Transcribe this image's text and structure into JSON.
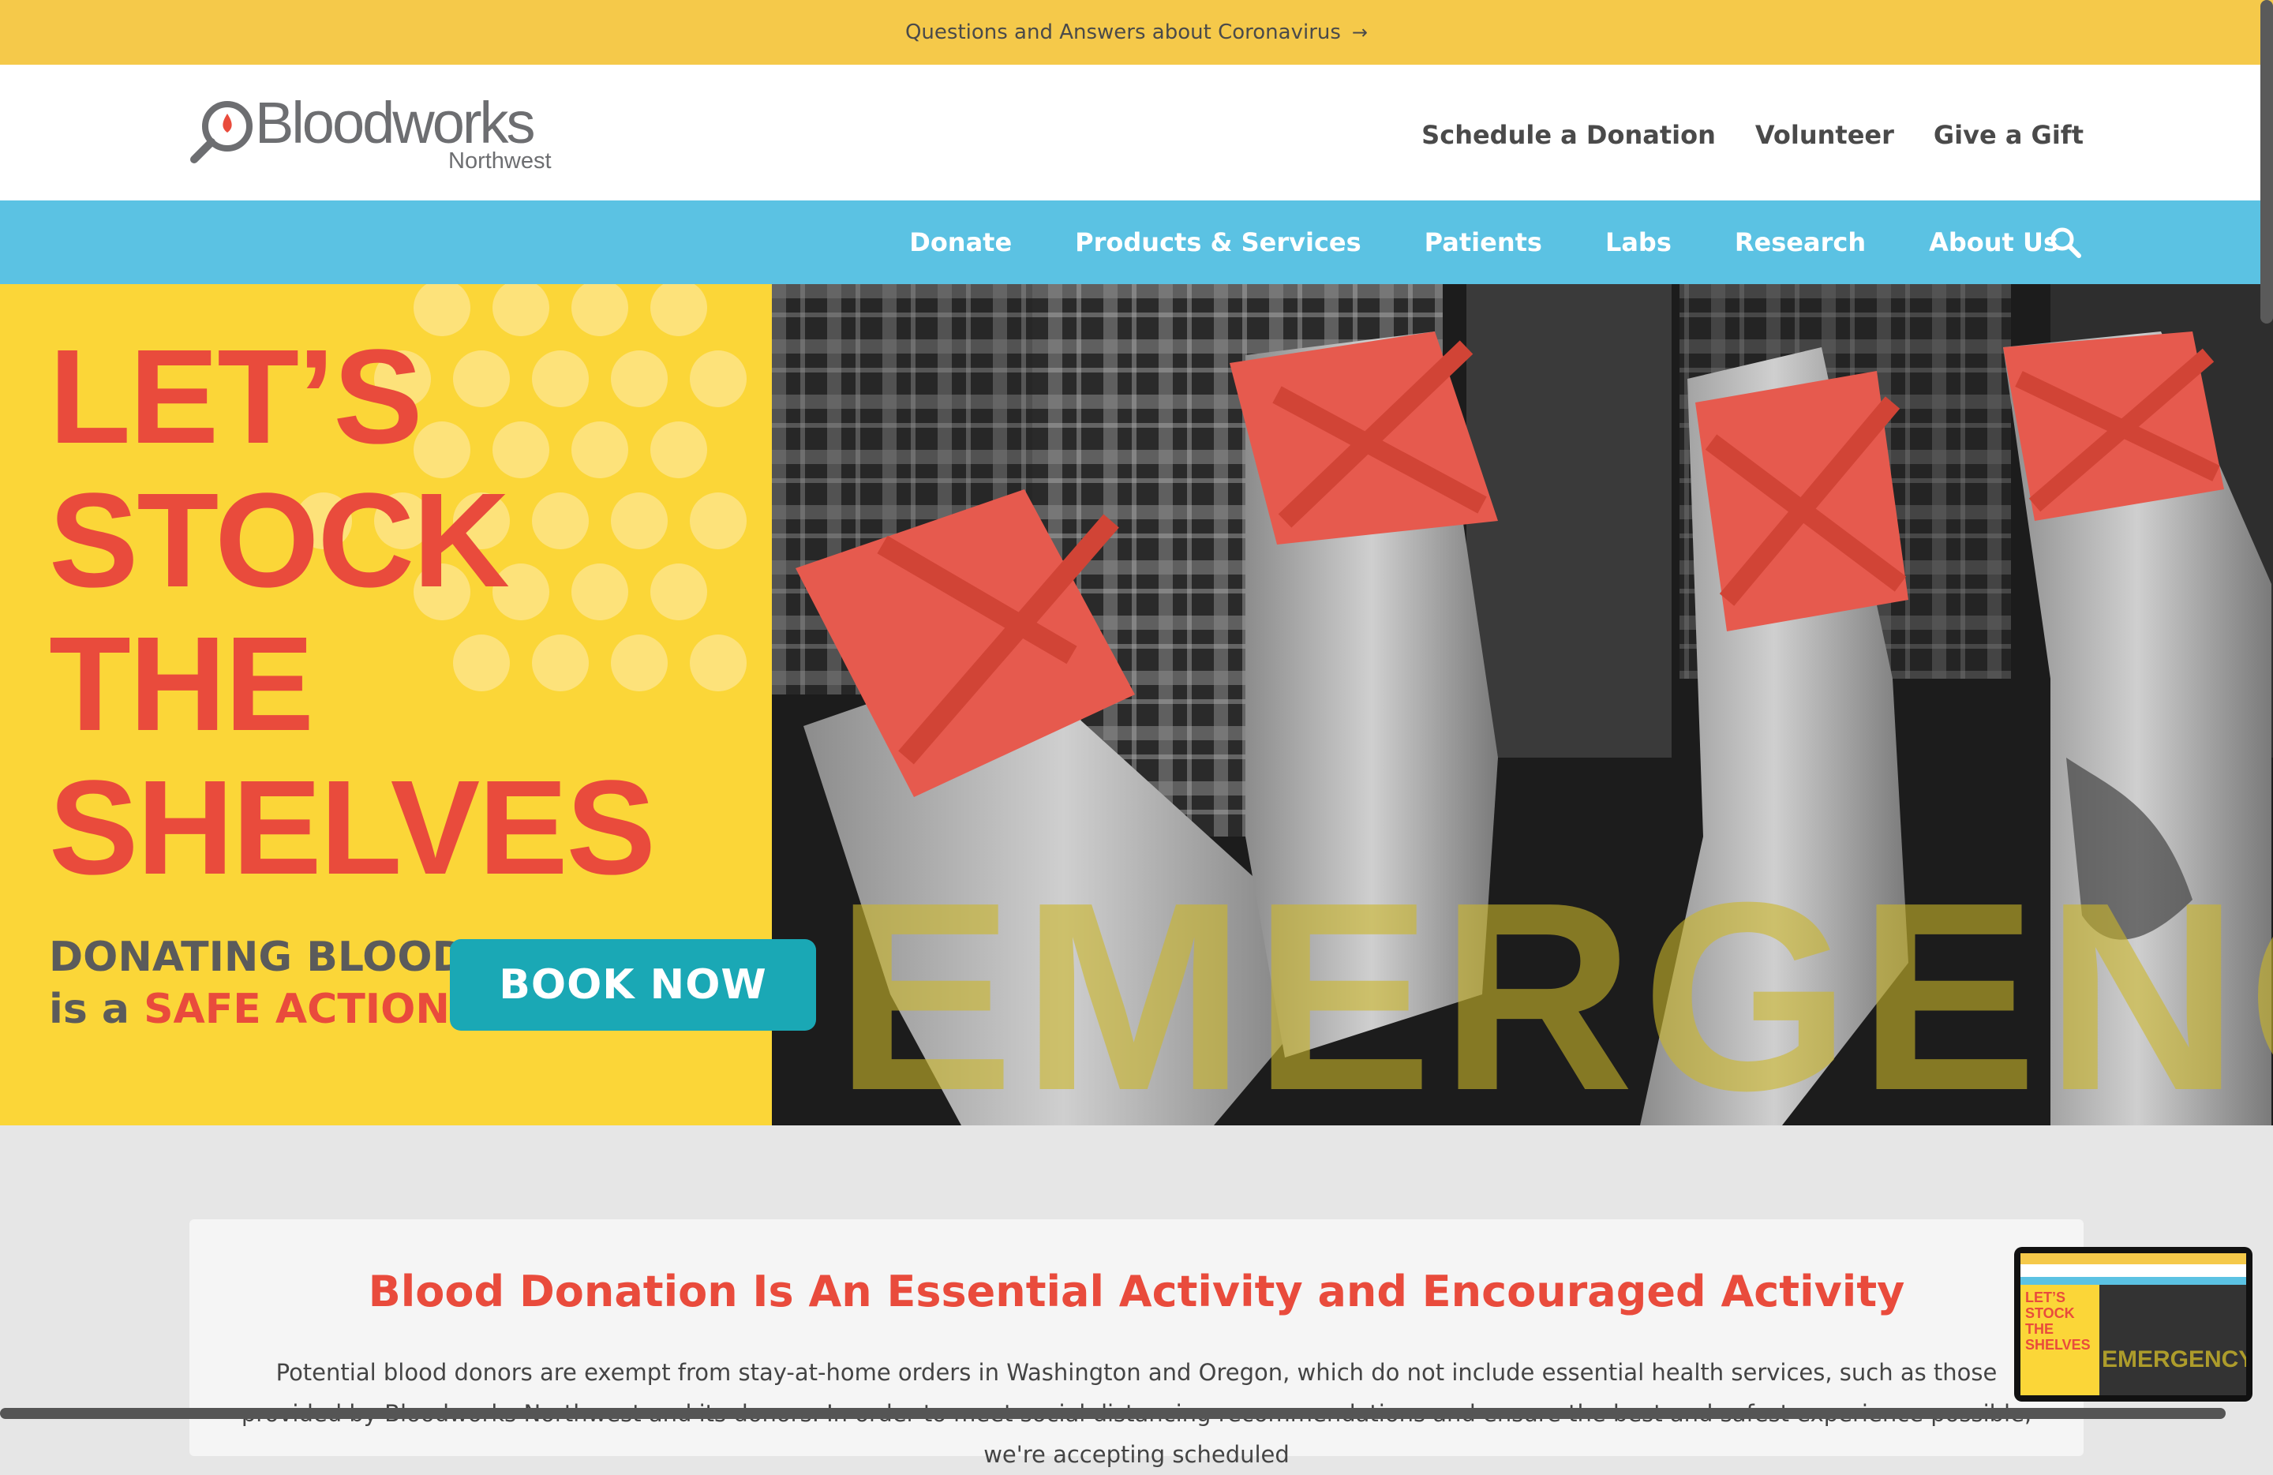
{
  "alert": {
    "text": "Questions and Answers about Coronavirus",
    "arrow": "→"
  },
  "logo": {
    "word": "Bloodworks",
    "sub": "Northwest"
  },
  "util_nav": [
    "Schedule a Donation",
    "Volunteer",
    "Give a Gift"
  ],
  "main_nav": [
    "Donate",
    "Products & Services",
    "Patients",
    "Labs",
    "Research",
    "About Us"
  ],
  "hero": {
    "headline_lines": [
      "LET’S",
      "STOCK",
      "THE",
      "SHELVES"
    ],
    "donating_line1": "DONATING BLOOD",
    "donating_prefix": "is a",
    "donating_safe": "SAFE ACTION",
    "book_now": "BOOK NOW",
    "emergency": "EMERGENCY"
  },
  "content": {
    "title": "Blood Donation Is An Essential Activity and Encouraged Activity",
    "body": "Potential blood donors are exempt from stay-at-home orders in Washington and Oregon, which do not include essential health services, such as those provided by Bloodworks Northwest and its donors. In order to meet social distancing recommendations and ensure the best and safest experience possible, we're accepting scheduled"
  },
  "thumbnail": {
    "headline_lines": [
      "LET’S",
      "STOCK",
      "THE",
      "SHELVES"
    ],
    "emergency": "EMERGENCY"
  },
  "colors": {
    "alert_bg": "#f5c94a",
    "nav_bg": "#5bc2e3",
    "hero_yellow": "#fbd638",
    "brand_red": "#e94b3c",
    "button_teal": "#1aa8b5"
  }
}
